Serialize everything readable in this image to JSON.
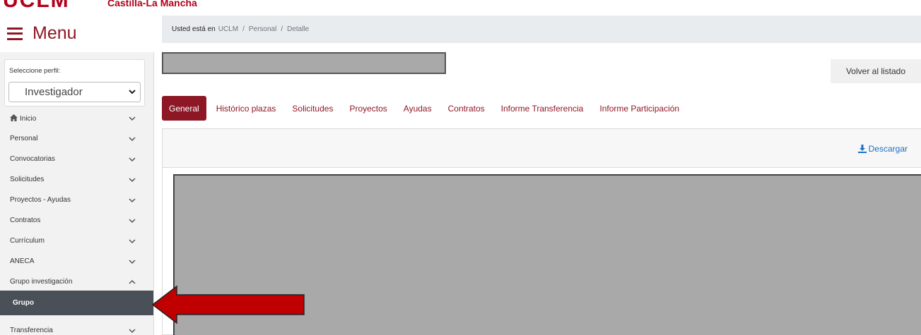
{
  "header": {
    "logo_text": "UCLM",
    "logo_subtitle": "Castilla-La Mancha",
    "menu_label": "Menu"
  },
  "breadcrumb": {
    "prefix": "Usted está en",
    "items": [
      "UCLM",
      "Personal",
      "Detalle"
    ]
  },
  "sidebar": {
    "profile_label": "Seleccione perfil:",
    "profile_value": "Investigador",
    "items": [
      {
        "label": "Inicio"
      },
      {
        "label": "Personal"
      },
      {
        "label": "Convocatorias"
      },
      {
        "label": "Solicitudes"
      },
      {
        "label": "Proyectos - Ayudas"
      },
      {
        "label": "Contratos"
      },
      {
        "label": "Currículum"
      },
      {
        "label": "ANECA"
      },
      {
        "label": "Grupo investigación"
      },
      {
        "label": "Grupo"
      },
      {
        "label": "Transferencia"
      }
    ]
  },
  "main": {
    "back_button": "Volver al listado",
    "tabs": [
      {
        "label": "General"
      },
      {
        "label": "Histórico plazas"
      },
      {
        "label": "Solicitudes"
      },
      {
        "label": "Proyectos"
      },
      {
        "label": "Ayudas"
      },
      {
        "label": "Contratos"
      },
      {
        "label": "Informe Transferencia"
      },
      {
        "label": "Informe Participación"
      }
    ],
    "download_label": "Descargar"
  },
  "colors": {
    "brand": "#8e1725",
    "active_nav_bg": "#495057",
    "link_blue": "#1f6fc6",
    "arrow_red": "#c00000"
  }
}
